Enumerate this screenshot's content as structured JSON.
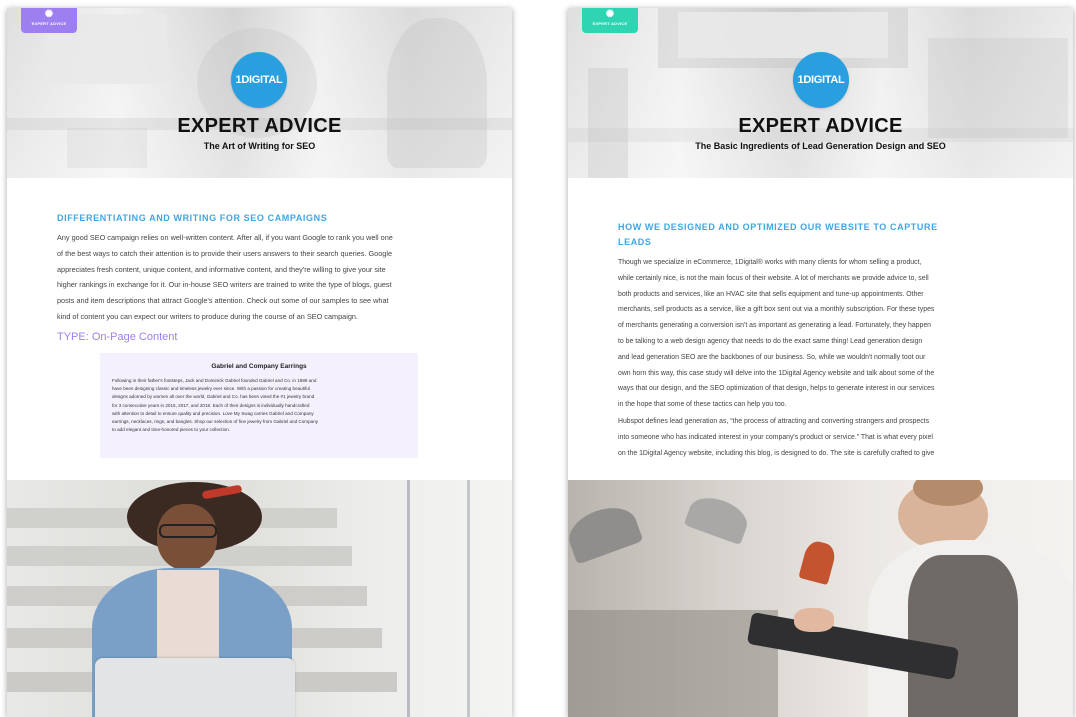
{
  "left_card": {
    "badge": "EXPERT ADVICE",
    "logo": "1DIGITAL",
    "title": "EXPERT ADVICE",
    "subtitle": "The Art of Writing for SEO",
    "heading": "DIFFERENTIATING AND WRITING FOR SEO CAMPAIGNS",
    "body_lines": [
      "Any good SEO campaign relies on well-written content. After all, if you want Google to rank you well one",
      "of the best ways to catch their attention is to provide their users answers to their search queries. Google",
      "appreciates fresh content, unique content, and informative content, and they're willing to give your site",
      "higher rankings in exchange for it. Our in-house SEO writers are trained to write the type of blogs, guest",
      "posts and item descriptions that attract Google's attention. Check out some of our samples to see what",
      "kind of content you can expect our writers to produce during the course of an SEO campaign."
    ],
    "type_label": "TYPE: On-Page Content",
    "sample_title": "Gabriel and Company Earrings",
    "sample_lines": [
      "Following in their father's footsteps, Jack and Dominick Gabriel founded Gabriel and Co. in 1989 and",
      "have been designing classic and timeless jewelry ever since. With a passion for creating beautiful",
      "designs adorned by women all over the world, Gabriel and Co. has been voted the #1 jewelry brand",
      "for 3 consecutive years in 2015, 2017, and 2018. Each of their designs is individually handcrafted",
      "with attention to detail to ensure quality and precision. Love My Swag carries Gabriel and Company",
      "earrings, necklaces, rings, and bangles. Shop our selection of fine jewelry from Gabriel and Company",
      "to add elegant and time-honored pieces to your collection."
    ]
  },
  "right_card": {
    "badge": "EXPERT ADVICE",
    "logo": "1DIGITAL",
    "title": "EXPERT ADVICE",
    "subtitle": "The Basic Ingredients of Lead Generation Design and SEO",
    "heading_lines": [
      "HOW WE DESIGNED AND OPTIMIZED OUR WEBSITE TO CAPTURE",
      "LEADS"
    ],
    "para1_lines": [
      "Though we specialize in eCommerce, 1Digital® works with many clients for whom selling a product,",
      "while certainly nice, is not the main focus of their website. A lot of merchants we provide advice to, sell",
      "both products and services, like an HVAC site that sells equipment and tune-up appointments. Other",
      "merchants, sell products as a service, like a gift box sent out via a monthly subscription. For these types",
      "of merchants generating a conversion isn't as important as generating a lead. Fortunately, they happen",
      "to be talking to a web design agency that needs to do the exact same thing! Lead generation design",
      "and lead generation SEO are the backbones of our business. So, while we wouldn't normally toot our",
      "own horn this way, this case study will delve into the 1Digital Agency website and talk about some of the",
      "ways that our design, and the SEO optimization of that design, helps to generate interest in our services",
      "in the hope that some of these tactics can help you too."
    ],
    "para2_lines": [
      "Hubspot defines lead generation as, “the process of attracting and converting strangers and prospects",
      "into someone who has indicated interest in your company's product or service.” That is what every pixel",
      "on the 1Digital Agency website, including this blog, is designed to do. The site is carefully crafted to give"
    ]
  },
  "colors": {
    "blue_heading": "#3ea6e2",
    "logo_blue": "#2a9fe0",
    "purple_accent": "#9d7ff0",
    "teal_accent": "#2fd4b2",
    "sample_bg": "#f5f0fe"
  },
  "icons": [
    "lightbulb-icon"
  ]
}
